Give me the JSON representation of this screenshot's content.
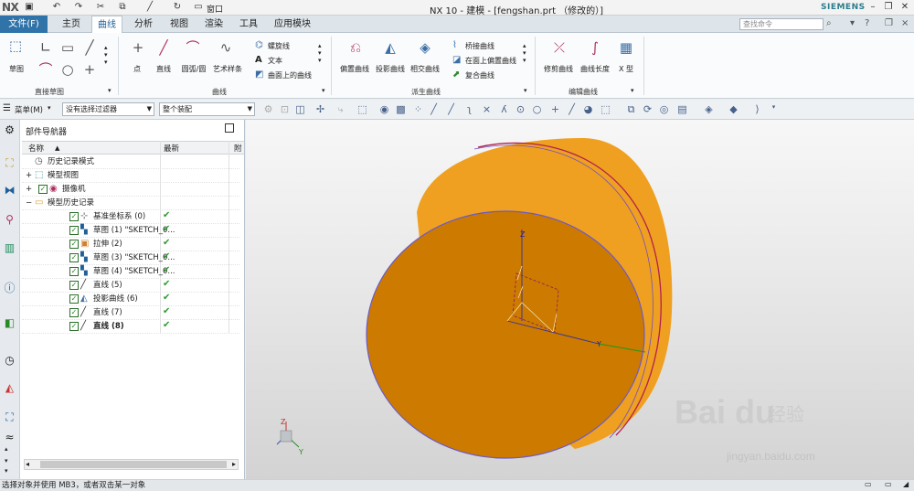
{
  "app": {
    "logo": "NX",
    "title": "NX 10 - 建模 - [fengshan.prt （修改的）]",
    "brand": "SIEMENS"
  },
  "quick_access": {
    "undo": "↶",
    "redo": "↷",
    "window_label": "窗口"
  },
  "menu": {
    "file": "文件(F)",
    "tabs": [
      "主页",
      "曲线",
      "分析",
      "视图",
      "渲染",
      "工具",
      "应用模块"
    ],
    "active_tab": "曲线",
    "search_placeholder": "查找命令"
  },
  "ribbon": {
    "direct_sketch_group": "直接草图",
    "sketch_label": "草图",
    "curve_group": "曲线",
    "curve_buttons": [
      "点",
      "直线",
      "圆弧/圆",
      "艺术样条"
    ],
    "curve_small": [
      "螺旋线",
      "文本",
      "曲面上的曲线"
    ],
    "derived_group": "派生曲线",
    "derived_buttons": [
      "偏置曲线",
      "投影曲线",
      "相交曲线"
    ],
    "derived_small": [
      "桥接曲线",
      "在面上偏置曲线",
      "复合曲线"
    ],
    "edit_group": "编辑曲线",
    "edit_buttons": [
      "修剪曲线",
      "曲线长度",
      "X 型"
    ]
  },
  "filterbar": {
    "menu_label": "菜单(M)",
    "filter": "没有选择过滤器",
    "assembly": "整个装配"
  },
  "navigator": {
    "title": "部件导航器",
    "columns": {
      "name": "名称",
      "latest": "最新",
      "extra": "附"
    },
    "rows": [
      {
        "label": "历史记录模式",
        "icon": "clock-icon",
        "indent": 0,
        "check": false,
        "latest": ""
      },
      {
        "label": "模型视图",
        "icon": "model-view-icon",
        "indent": 0,
        "check": false,
        "latest": "",
        "expand": "+"
      },
      {
        "label": "摄像机",
        "icon": "camera-icon",
        "indent": 0,
        "check": true,
        "latest": "",
        "expand": "+"
      },
      {
        "label": "模型历史记录",
        "icon": "folder-icon",
        "indent": 0,
        "check": false,
        "latest": "",
        "expand": "−"
      },
      {
        "label": "基准坐标系 (0)",
        "icon": "datum-csys-icon",
        "indent": 1,
        "check": true,
        "latest": "✔"
      },
      {
        "label": "草图 (1) \"SKETCH_0...",
        "icon": "sketch-icon",
        "indent": 1,
        "check": true,
        "latest": "✔"
      },
      {
        "label": "拉伸 (2)",
        "icon": "extrude-icon",
        "indent": 1,
        "check": true,
        "latest": "✔"
      },
      {
        "label": "草图 (3) \"SKETCH_0...",
        "icon": "sketch-icon",
        "indent": 1,
        "check": true,
        "latest": "✔"
      },
      {
        "label": "草图 (4) \"SKETCH_0...",
        "icon": "sketch-icon",
        "indent": 1,
        "check": true,
        "latest": "✔"
      },
      {
        "label": "直线 (5)",
        "icon": "line-icon",
        "indent": 1,
        "check": true,
        "latest": "✔"
      },
      {
        "label": "投影曲线 (6)",
        "icon": "projected-curve-icon",
        "indent": 1,
        "check": true,
        "latest": "✔"
      },
      {
        "label": "直线 (7)",
        "icon": "line-icon",
        "indent": 1,
        "check": true,
        "latest": "✔"
      },
      {
        "label": "直线 (8)",
        "icon": "line-icon",
        "indent": 1,
        "check": true,
        "latest": "✔",
        "bold": true
      }
    ]
  },
  "viewport": {
    "body_color": "#cc7a00",
    "side_color": "#f0a020",
    "triad_labels": {
      "x": "X",
      "y": "Y",
      "z": "Z"
    }
  },
  "watermark": {
    "logo": "Bai du",
    "cn": "经验",
    "url": "jingyan.baidu.com"
  },
  "status": "选择对象并使用 MB3，或者双击某一对象"
}
